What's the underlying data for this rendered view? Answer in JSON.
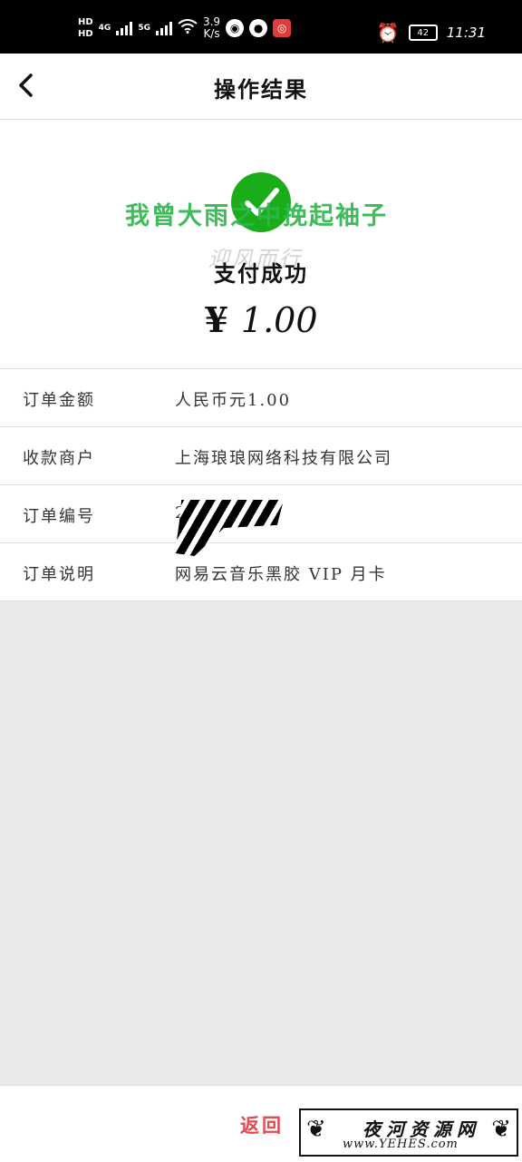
{
  "status_bar": {
    "hd1": "HD",
    "hd2": "HD",
    "network1": "4G",
    "network2": "5G",
    "speed_value": "3.9",
    "speed_unit": "K/s",
    "battery": "42",
    "time": "11:31"
  },
  "nav": {
    "title": "操作结果"
  },
  "watermark": {
    "line1": "我曾大雨之中挽起袖子",
    "line2": "迎风而行"
  },
  "result": {
    "status": "支付成功",
    "currency_symbol": "¥",
    "amount": "1.00"
  },
  "details": [
    {
      "label": "订单金额",
      "value": "人民币元1.00"
    },
    {
      "label": "收款商户",
      "value": "上海琅琅网络科技有限公司"
    },
    {
      "label": "订单编号",
      "value": "2,"
    },
    {
      "label": "订单说明",
      "value": "网易云音乐黑胶 VIP 月卡"
    }
  ],
  "footer": {
    "return_label": "返回",
    "logo_name": "夜河资源网",
    "logo_url": "www.YEHES.com"
  },
  "colors": {
    "success": "#1aad19",
    "return_link": "#e5484d"
  }
}
